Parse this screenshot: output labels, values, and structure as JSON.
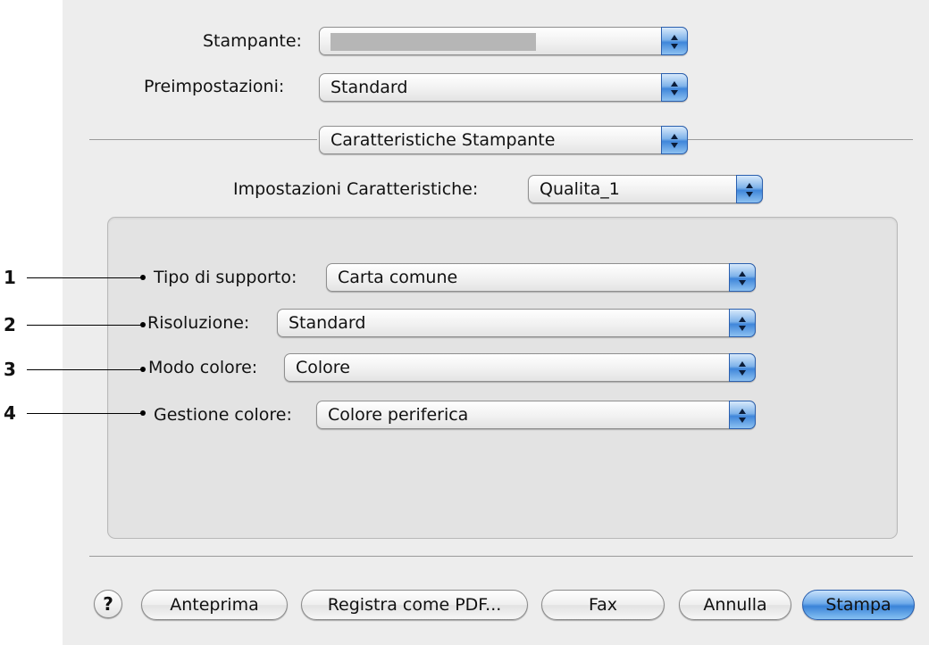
{
  "printer": {
    "label": "Stampante:",
    "value": ""
  },
  "presets": {
    "label": "Preimpostazioni:",
    "value": "Standard"
  },
  "pane_menu": {
    "value": "Caratteristiche Stampante"
  },
  "feature_sets": {
    "label": "Impostazioni Caratteristiche:",
    "value": "Qualita_1"
  },
  "options": [
    {
      "callout": "1",
      "label": "Tipo di supporto:",
      "value": "Carta comune"
    },
    {
      "callout": "2",
      "label": "Risoluzione:",
      "value": "Standard"
    },
    {
      "callout": "3",
      "label": "Modo colore:",
      "value": "Colore"
    },
    {
      "callout": "4",
      "label": "Gestione colore:",
      "value": "Colore periferica"
    }
  ],
  "buttons": {
    "help": "?",
    "preview": "Anteprima",
    "save_pdf": "Registra come PDF...",
    "fax": "Fax",
    "cancel": "Annulla",
    "print": "Stampa"
  },
  "icons": {
    "popup_arrows": "up-down-arrows-icon",
    "help": "question-mark-icon"
  },
  "colors": {
    "accent": "#3f86da",
    "panel": "#ededed",
    "group": "#e3e3e3"
  }
}
